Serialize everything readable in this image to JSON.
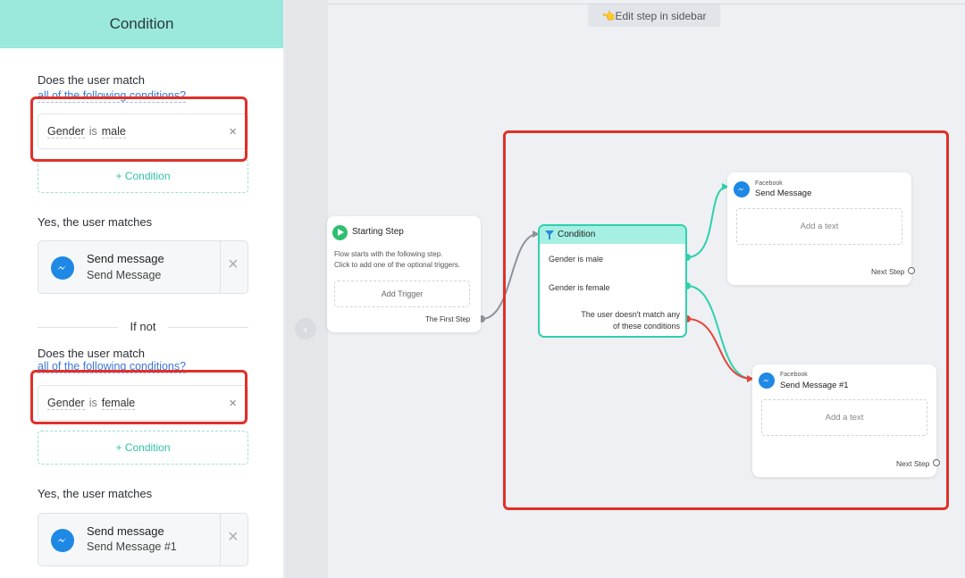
{
  "sidebar": {
    "header": "Condition",
    "block1": {
      "question": "Does the user match",
      "mode_link": "all of the following conditions?",
      "condition": {
        "field": "Gender",
        "op": "is",
        "value": "male"
      },
      "add_condition": "+ Condition",
      "matches_label": "Yes, the user matches",
      "message": {
        "title": "Send message",
        "subtitle": "Send Message"
      }
    },
    "if_not": "If not",
    "block2": {
      "question": "Does the user match",
      "mode_link": "all of the following conditions?",
      "condition": {
        "field": "Gender",
        "op": "is",
        "value": "female"
      },
      "add_condition": "+ Condition",
      "matches_label": "Yes, the user matches",
      "message": {
        "title": "Send message",
        "subtitle": "Send Message #1"
      }
    },
    "remove_glyph": "×"
  },
  "canvas": {
    "hint": "👈Edit step in sidebar",
    "collapse_glyph": "‹",
    "start_node": {
      "title": "Starting Step",
      "desc_line1": "Flow starts with the following step.",
      "desc_line2": "Click to add one of the optional triggers.",
      "add_trigger": "Add Trigger",
      "output": "The First Step"
    },
    "condition_node": {
      "title": "Condition",
      "rows": [
        "Gender is male",
        "Gender is female"
      ],
      "else_line1": "The user doesn't match any",
      "else_line2": "of these conditions"
    },
    "message_node_1": {
      "channel": "Facebook",
      "title": "Send Message",
      "add_text": "Add a text",
      "next": "Next Step"
    },
    "message_node_2": {
      "channel": "Facebook",
      "title": "Send Message #1",
      "add_text": "Add a text",
      "next": "Next Step"
    }
  },
  "colors": {
    "accent_teal": "#2fd0ae",
    "header_teal": "#9ae9dc",
    "messenger_blue": "#1e88e5",
    "highlight_red": "#e0302a",
    "else_red": "#e0463a",
    "start_green": "#2fbf71"
  },
  "icons": [
    "play-icon",
    "filter-icon",
    "messenger-icon",
    "close-icon",
    "chevron-left-icon"
  ]
}
